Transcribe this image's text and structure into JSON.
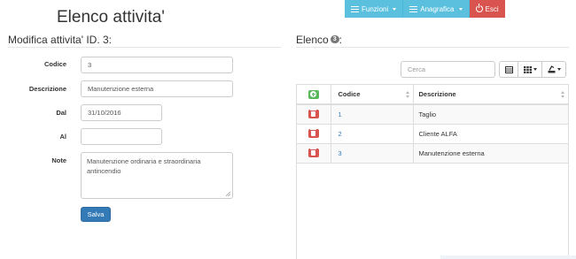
{
  "nav": {
    "funzioni_label": "Funzioni",
    "anagrafica_label": "Anagrafica",
    "esci_label": "Esci"
  },
  "app_title": "Elenco attivita'",
  "form": {
    "title": "Modifica attivita' ID. 3:",
    "codice_label": "Codice",
    "codice_value": "3",
    "descrizione_label": "Descrizione",
    "descrizione_value": "Manutenzione esterna",
    "dal_label": "Dal",
    "dal_value": "31/10/2016",
    "al_label": "Al",
    "al_value": "",
    "note_label": "Note",
    "note_value": "Manutenzione ordinaria e straordinaria antincendio",
    "save_label": "Salva"
  },
  "list": {
    "title": "Elenco",
    "count": "3",
    "search_placeholder": "Cerca",
    "columns": [
      "Codice",
      "Descrizione"
    ],
    "rows": [
      {
        "codice": "1",
        "descrizione": "Taglio"
      },
      {
        "codice": "2",
        "descrizione": "Cliente ALFA"
      },
      {
        "codice": "3",
        "descrizione": "Manutenzione esterna"
      }
    ]
  },
  "colors": {
    "nav_info": "#5bc0de",
    "nav_danger": "#d9534f",
    "primary": "#337ab7",
    "success": "#5cb85c"
  },
  "icons": [
    "list-icon",
    "power-icon",
    "columns-icon",
    "grid-icon",
    "export-icon",
    "plus-icon",
    "trash-icon",
    "sort-icon"
  ]
}
